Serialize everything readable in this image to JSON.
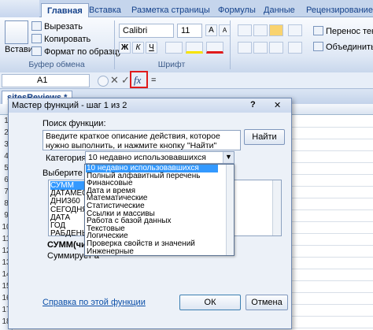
{
  "ribbon": {
    "file_tab": "",
    "tabs": [
      "Главная",
      "Вставка",
      "Разметка страницы",
      "Формулы",
      "Данные",
      "Рецензирование"
    ],
    "clipboard": {
      "paste_label": "Вставить",
      "cut_label": "Вырезать",
      "copy_label": "Копировать",
      "format_painter_label": "Формат по образцу",
      "group_label": "Буфер обмена"
    },
    "font": {
      "font_name": "Calibri",
      "font_size": "11",
      "bold": "Ж",
      "italic": "К",
      "underline": "Ч",
      "grow": "A",
      "shrink": "A",
      "group_label": "Шрифт"
    },
    "alignment": {
      "wrap_text_label": "Перенос текст",
      "merge_label": "Объединить и"
    }
  },
  "formula_bar": {
    "name_box": "A1",
    "cancel_symbol": "✕",
    "enter_symbol": "✓",
    "fx_label": "fx",
    "content": "="
  },
  "workbook": {
    "tab_title": "sitesReviews *",
    "cell_a1": "=",
    "row_numbers": [
      "1",
      "2",
      "3",
      "4",
      "5",
      "6",
      "7",
      "8",
      "9",
      "10",
      "11",
      "12",
      "13",
      "14",
      "15",
      "16",
      "17",
      "18"
    ]
  },
  "dialog": {
    "title": "Мастер функций - шаг 1 из 2",
    "help_symbol": "?",
    "close_symbol": "✕",
    "search_label": "Поиск функции:",
    "search_text": "Введите краткое описание действия, которое нужно выполнить, и нажмите кнопку \"Найти\"",
    "find_button": "Найти",
    "category_label": "Категория:",
    "category_value": "10 недавно использовавшихся",
    "select_function_label": "Выберите функ",
    "functions": [
      "СУММ",
      "ДАТАМЕС",
      "ДНИ360",
      "СЕГОДНЯ",
      "ДАТА",
      "ГОД",
      "РАБДЕНЬ"
    ],
    "signature": "СУММ(числ",
    "description": "Суммирует а",
    "categories": [
      "10 недавно использовавшихся",
      "Полный алфавитный перечень",
      "Финансовые",
      "Дата и время",
      "Математические",
      "Статистические",
      "Ссылки и массивы",
      "Работа с базой данных",
      "Текстовые",
      "Логические",
      "Проверка свойств и значений",
      "Инженерные"
    ],
    "help_link": "Справка по этой функции",
    "ok_button": "ОК",
    "cancel_button": "Отмена"
  },
  "colors": {
    "ribbon_blue": "#c5d5ec",
    "selection": "#3399ff",
    "highlight_box": "#e01b1b",
    "link": "#0b4fa8"
  }
}
